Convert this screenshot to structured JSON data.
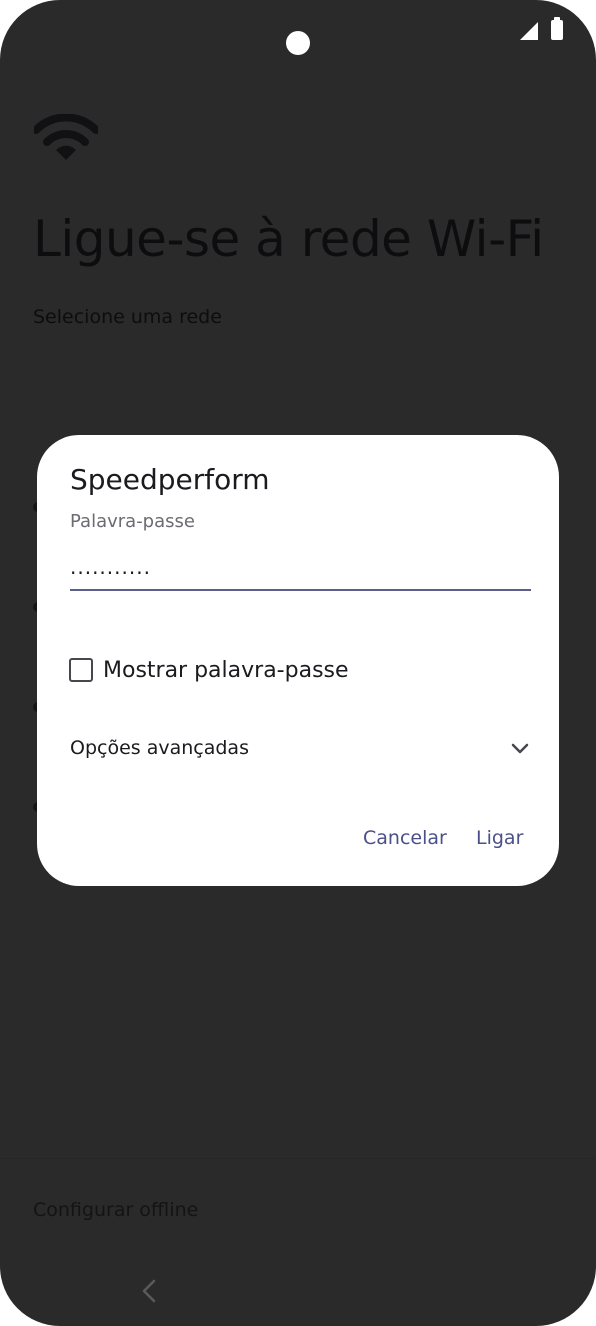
{
  "setup_screen": {
    "title": "Ligue-se à rede Wi-Fi",
    "subtitle": "Selecione uma rede",
    "offline_link": "Configurar offline"
  },
  "dialog": {
    "network_name": "Speedperform",
    "password_label": "Palavra-passe",
    "password_value": "...........",
    "show_password_label": "Mostrar palavra-passe",
    "show_password_checked": false,
    "advanced_options_label": "Opções avançadas",
    "cancel_label": "Cancelar",
    "connect_label": "Ligar"
  },
  "colors": {
    "scrim": "#2a2a2a",
    "dialog_bg": "#ffffff",
    "accent": "#4b5088",
    "underline": "#5a5f8c"
  },
  "icons": {
    "status_signal": "cellular-signal-icon",
    "status_battery": "battery-icon",
    "header": "wifi-icon",
    "advanced_toggle": "chevron-down-icon",
    "nav": "back-icon"
  }
}
